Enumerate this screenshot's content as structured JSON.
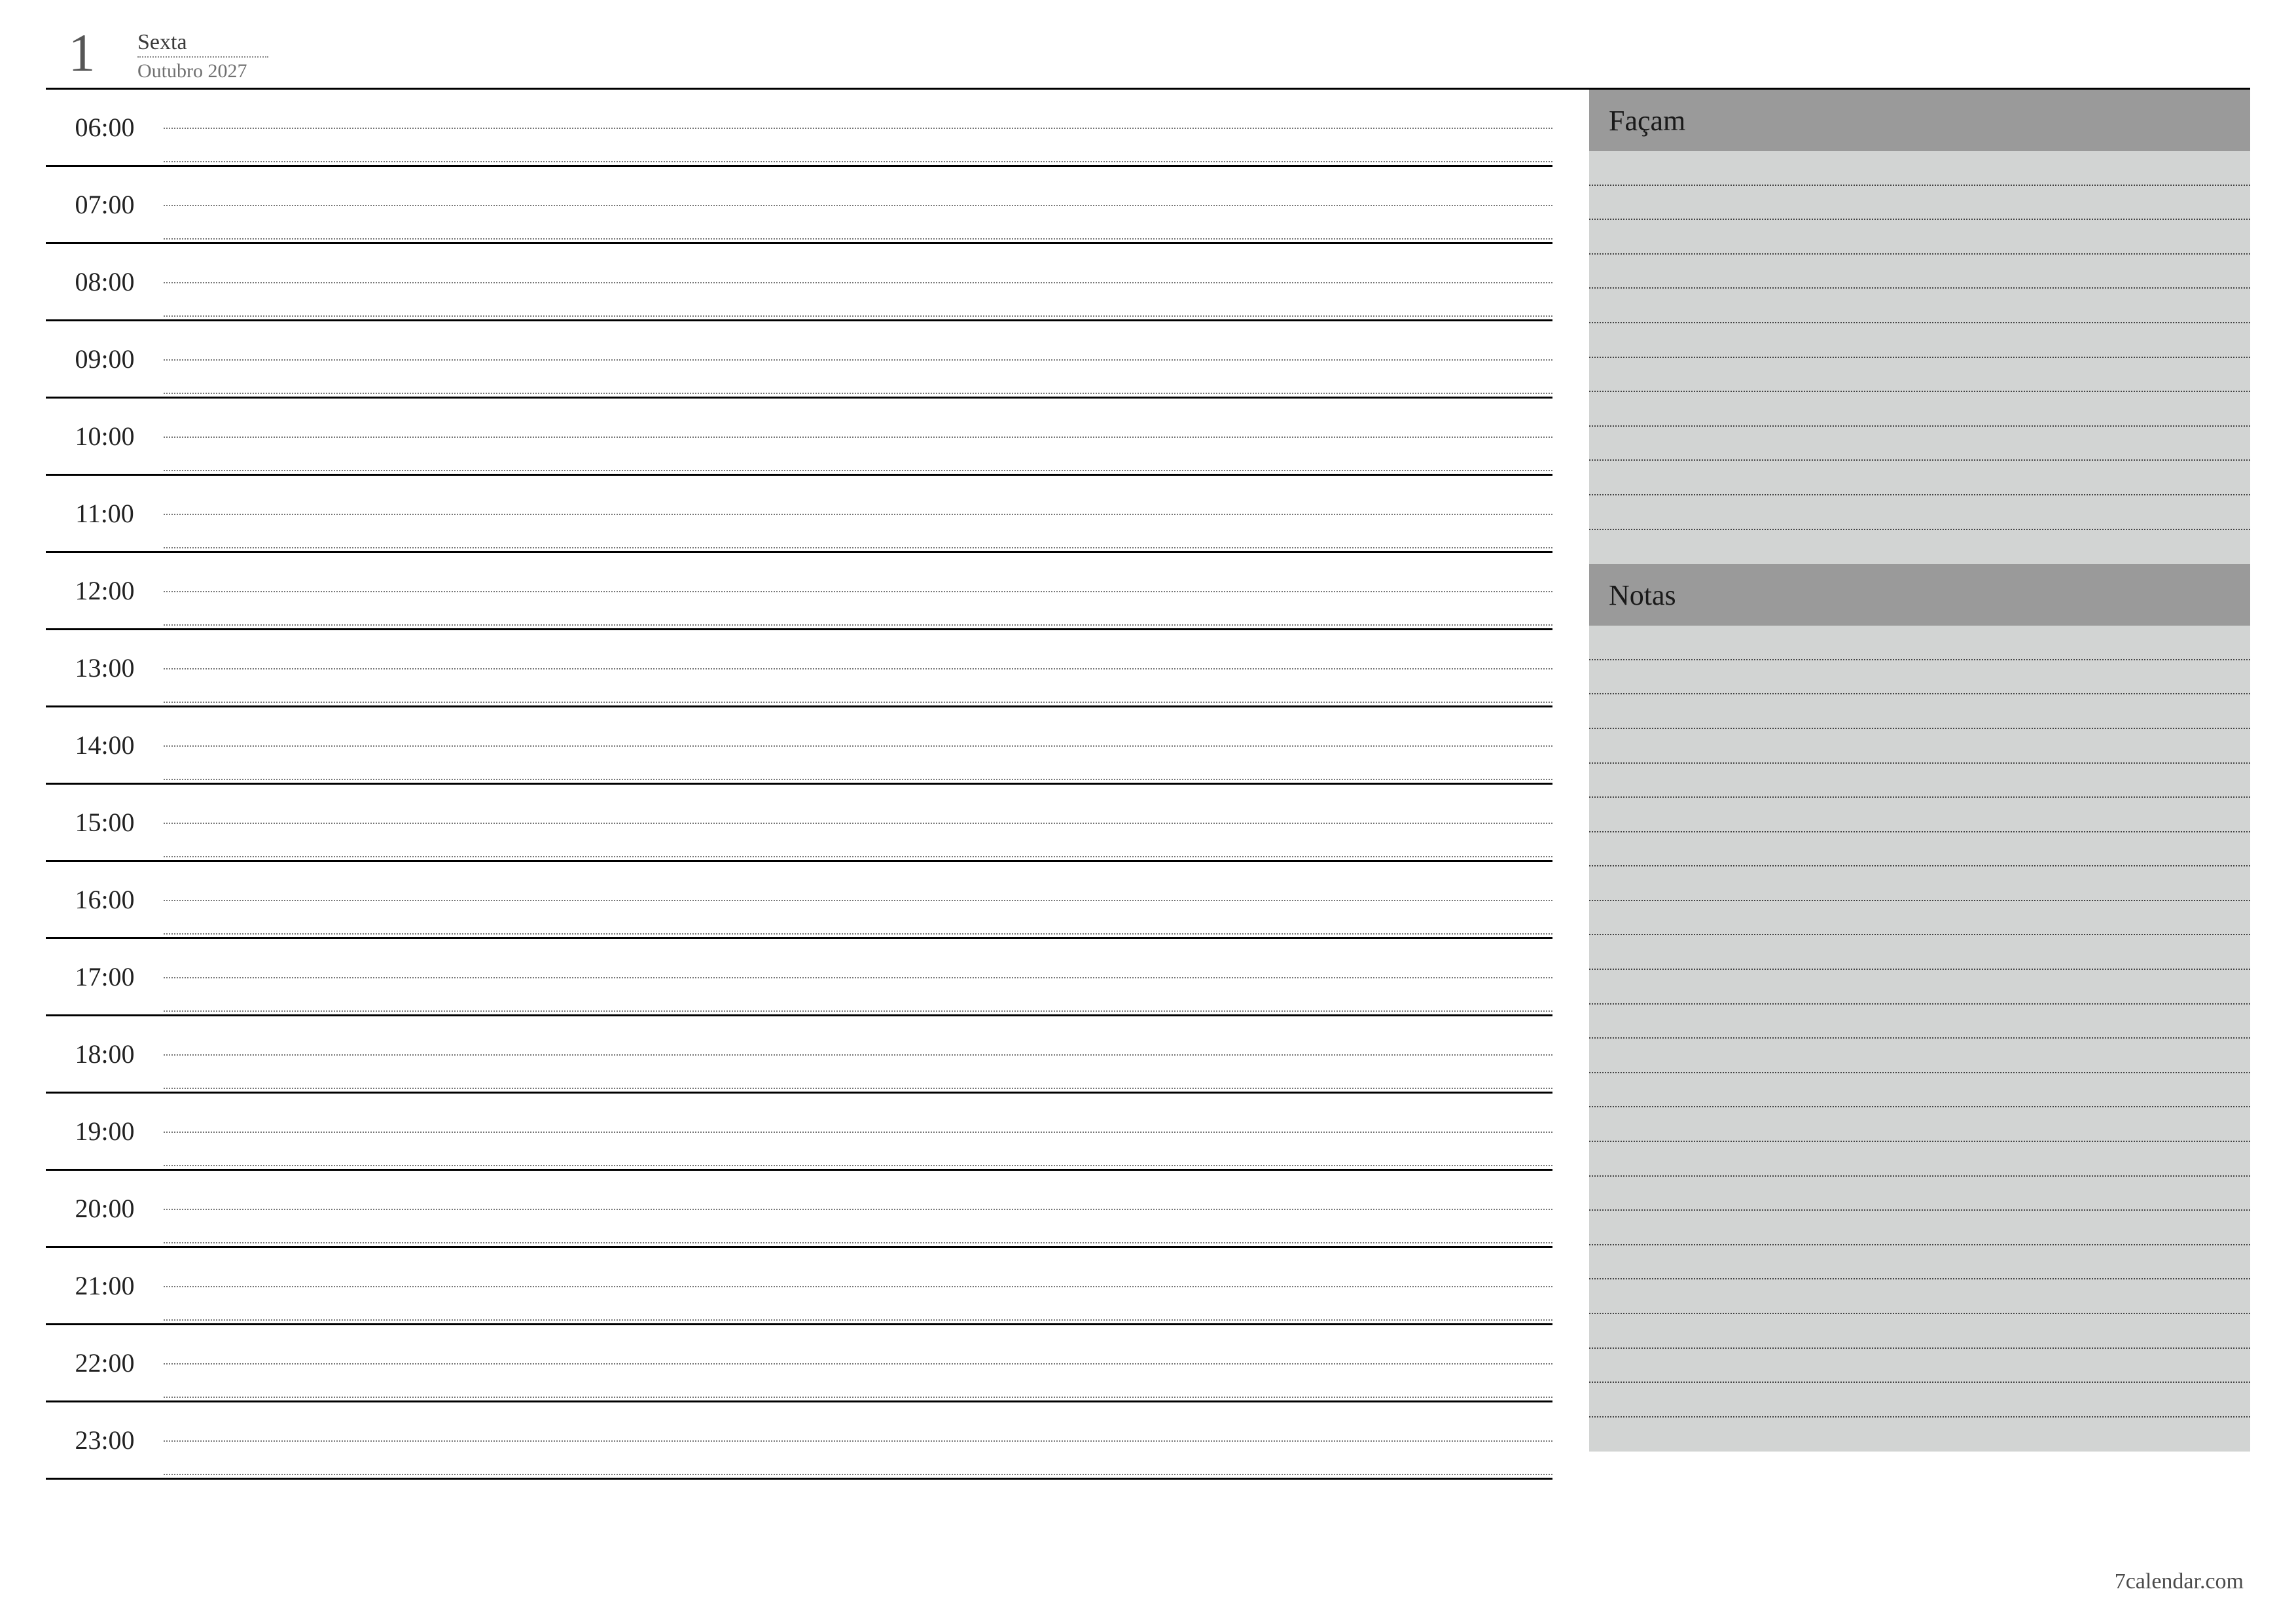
{
  "header": {
    "day_number": "1",
    "weekday": "Sexta",
    "month_year": "Outubro 2027"
  },
  "schedule": {
    "hours": [
      "06:00",
      "07:00",
      "08:00",
      "09:00",
      "10:00",
      "11:00",
      "12:00",
      "13:00",
      "14:00",
      "15:00",
      "16:00",
      "17:00",
      "18:00",
      "19:00",
      "20:00",
      "21:00",
      "22:00",
      "23:00"
    ]
  },
  "sidebar": {
    "todo": {
      "title": "Façam",
      "lines": 12
    },
    "notes": {
      "title": "Notas",
      "lines": 24
    }
  },
  "footer": {
    "credit": "7calendar.com"
  }
}
